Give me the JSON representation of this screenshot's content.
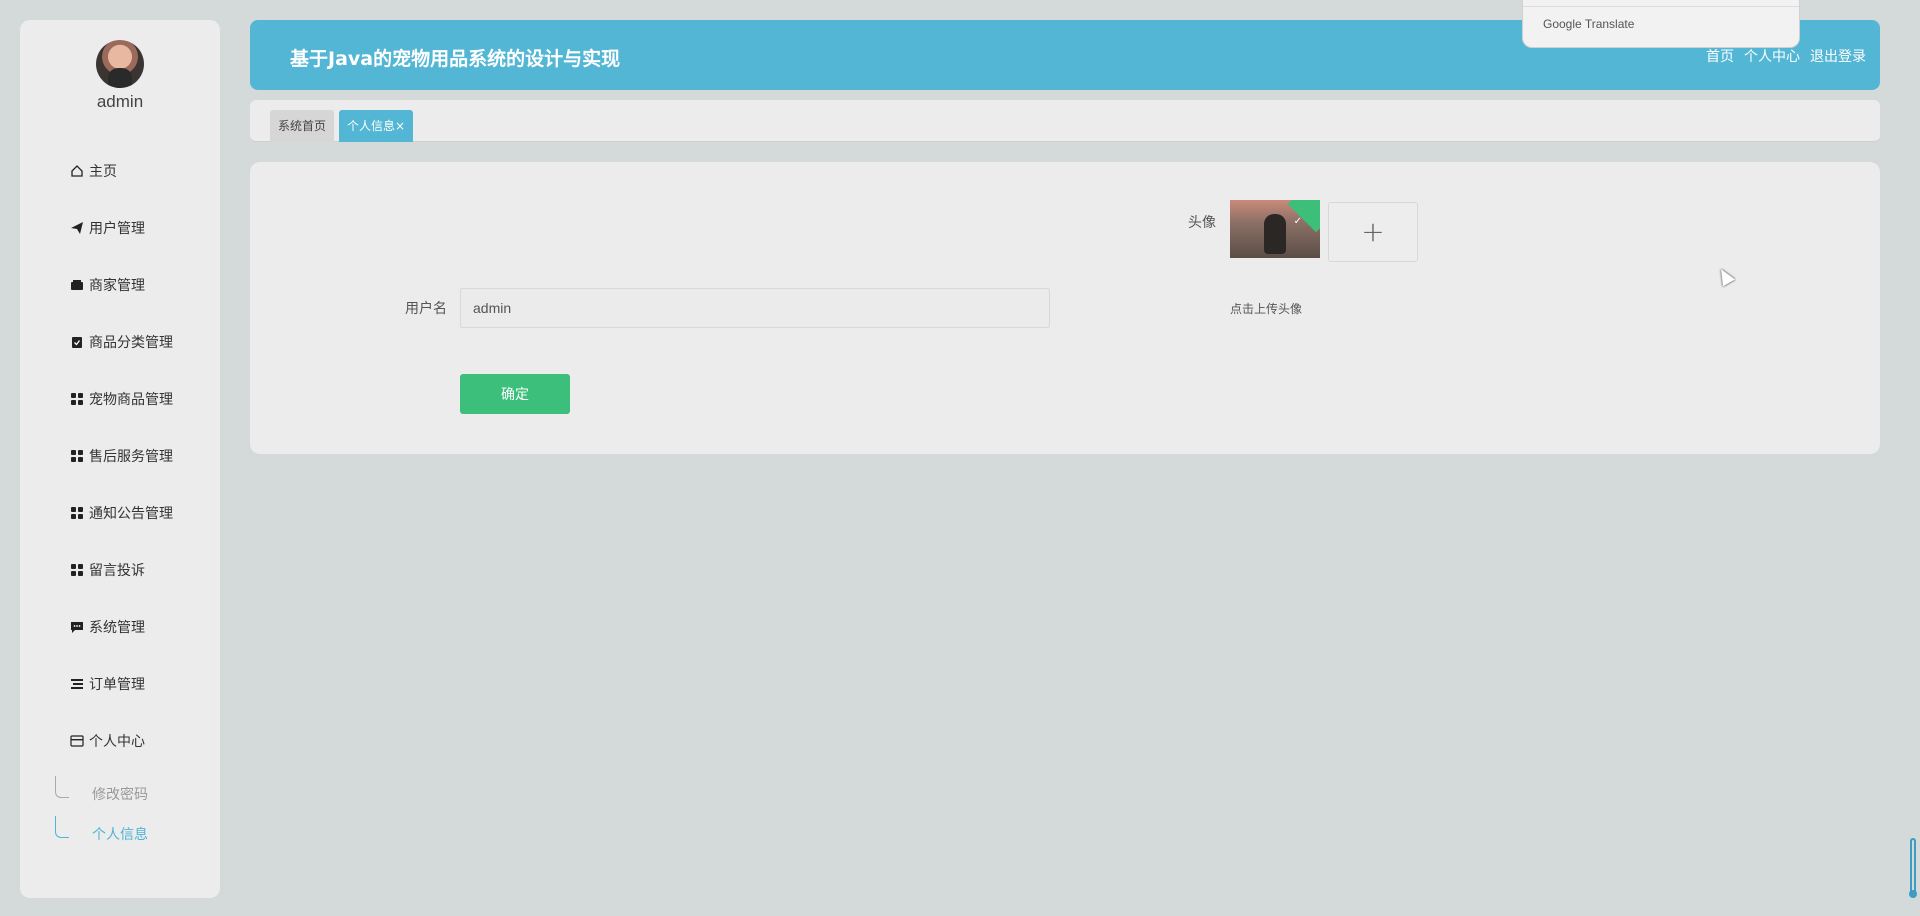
{
  "user": {
    "name": "admin"
  },
  "sidebar": {
    "items": [
      {
        "label": "主页",
        "icon": "home-icon"
      },
      {
        "label": "用户管理",
        "icon": "paper-plane-icon"
      },
      {
        "label": "商家管理",
        "icon": "wallet-icon"
      },
      {
        "label": "商品分类管理",
        "icon": "clipboard-check-icon"
      },
      {
        "label": "宠物商品管理",
        "icon": "grid-icon"
      },
      {
        "label": "售后服务管理",
        "icon": "grid-icon"
      },
      {
        "label": "通知公告管理",
        "icon": "grid-icon"
      },
      {
        "label": "留言投诉",
        "icon": "grid-icon"
      },
      {
        "label": "系统管理",
        "icon": "comment-icon"
      },
      {
        "label": "订单管理",
        "icon": "list-icon"
      },
      {
        "label": "个人中心",
        "icon": "card-icon"
      }
    ],
    "sub_items": [
      {
        "label": "修改密码",
        "active": false
      },
      {
        "label": "个人信息",
        "active": true
      }
    ]
  },
  "header": {
    "title": "基于Java的宠物用品系统的设计与实现",
    "links": {
      "home": "首页",
      "profile": "个人中心",
      "logout": "退出登录"
    },
    "accent_color": "#52b6d4"
  },
  "translate_popup": {
    "text": "Google Translate"
  },
  "tabs": {
    "home": "系统首页",
    "profile": "个人信息",
    "close_glyph": "×"
  },
  "form": {
    "avatar_label": "头像",
    "upload_hint": "点击上传头像",
    "upload_plus": "+",
    "username_label": "用户名",
    "username_value": "admin",
    "confirm_label": "确定",
    "confirm_color": "#3bbf7b"
  }
}
